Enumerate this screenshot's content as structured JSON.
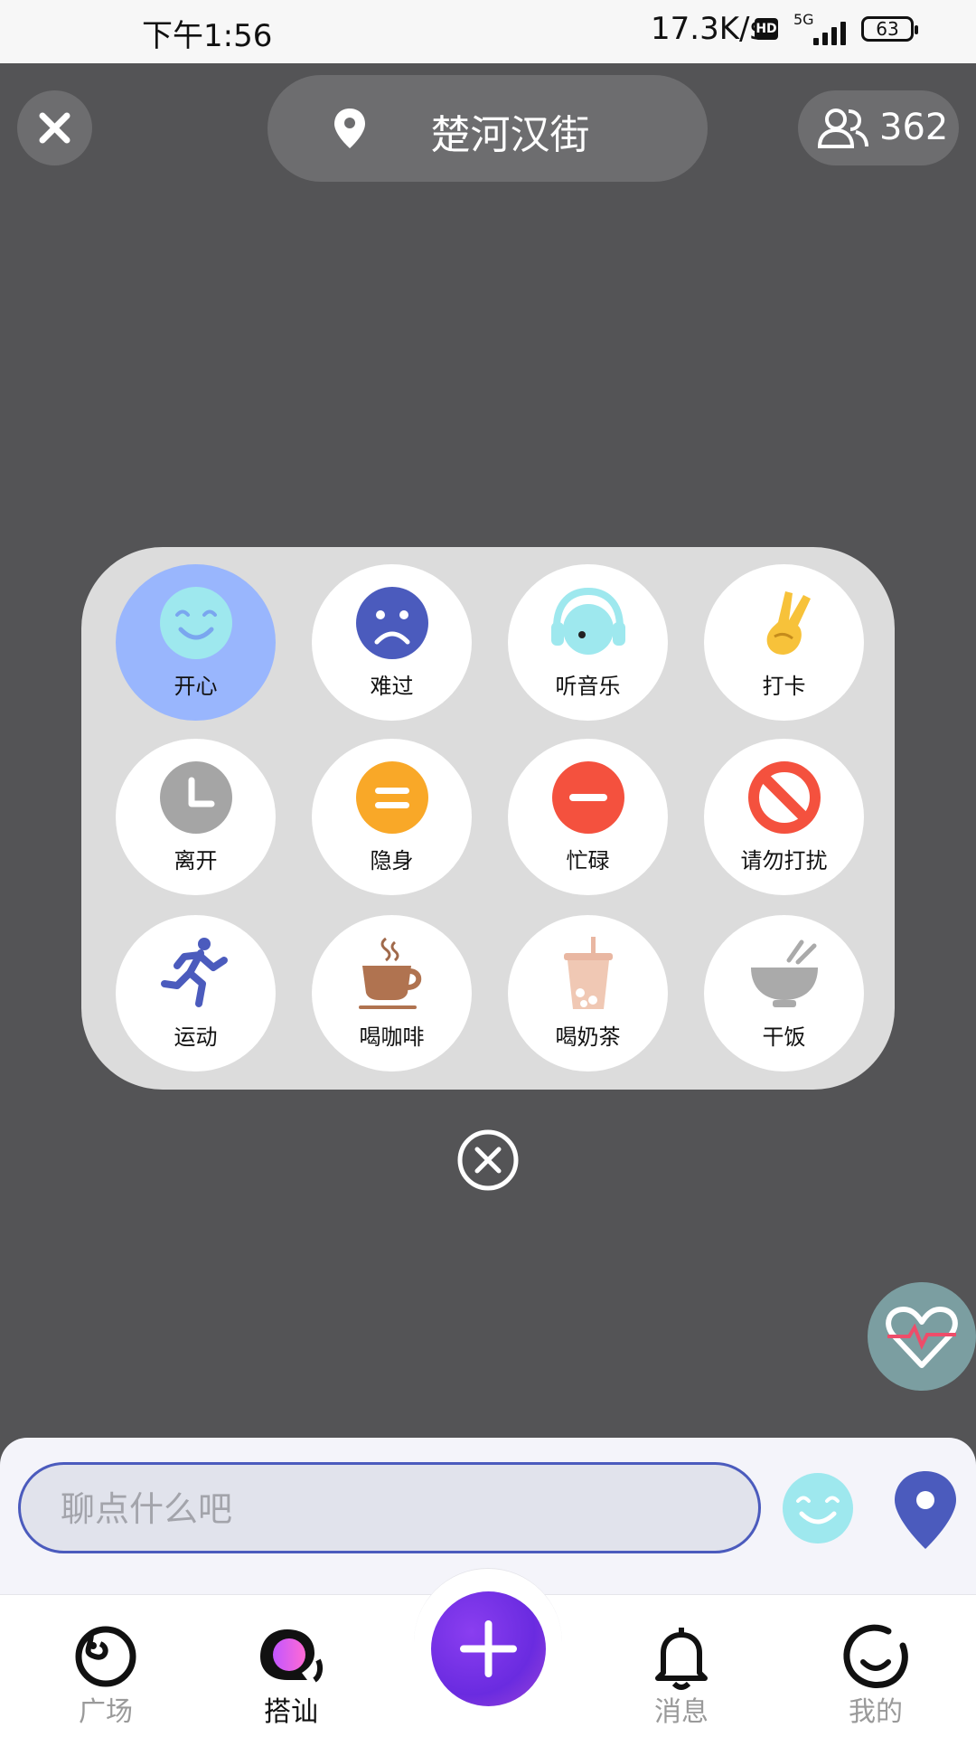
{
  "status_bar": {
    "time": "下午1:56",
    "network_speed": "17.3K/s",
    "hd": "HD",
    "network_type": "5G",
    "battery": "63"
  },
  "header": {
    "location_name": "楚河汉街",
    "online_count": "362"
  },
  "mood_panel": {
    "items": [
      {
        "label": "开心",
        "icon": "happy-face-icon",
        "selected": true
      },
      {
        "label": "难过",
        "icon": "sad-face-icon",
        "selected": false
      },
      {
        "label": "听音乐",
        "icon": "headphones-icon",
        "selected": false
      },
      {
        "label": "打卡",
        "icon": "victory-hand-icon",
        "selected": false
      },
      {
        "label": "离开",
        "icon": "clock-icon",
        "selected": false
      },
      {
        "label": "隐身",
        "icon": "invisible-icon",
        "selected": false
      },
      {
        "label": "忙碌",
        "icon": "busy-icon",
        "selected": false
      },
      {
        "label": "请勿打扰",
        "icon": "do-not-disturb-icon",
        "selected": false
      },
      {
        "label": "运动",
        "icon": "running-icon",
        "selected": false
      },
      {
        "label": "喝咖啡",
        "icon": "coffee-icon",
        "selected": false
      },
      {
        "label": "喝奶茶",
        "icon": "milk-tea-icon",
        "selected": false
      },
      {
        "label": "干饭",
        "icon": "rice-bowl-icon",
        "selected": false
      }
    ]
  },
  "chat": {
    "placeholder": "聊点什么吧"
  },
  "tabbar": {
    "items": [
      {
        "label": "广场",
        "active": false
      },
      {
        "label": "搭讪",
        "active": true
      },
      {
        "label": "消息",
        "active": false
      },
      {
        "label": "我的",
        "active": false
      }
    ]
  },
  "colors": {
    "overlay": "#545456",
    "selected_mood": "#99b6fd",
    "accent_purple": "#6a2be0",
    "accent_blue": "#4b5bbd"
  }
}
